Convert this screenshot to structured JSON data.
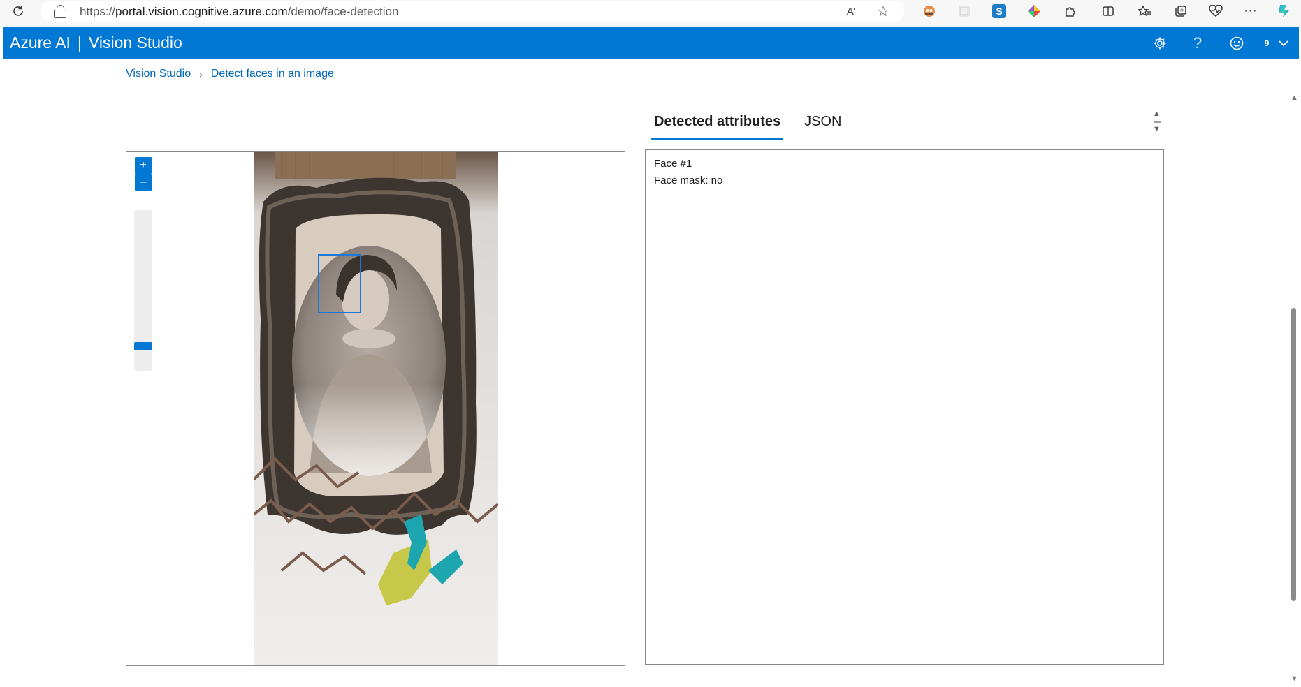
{
  "browser": {
    "url_prefix": "https://",
    "url_host": "portal.vision.cognitive.azure.com",
    "url_path": "/demo/face-detection",
    "refresh_icon": "refresh-icon",
    "lock_icon": "lock-icon",
    "read_aloud_label": "A’",
    "extension_icons": [
      "favorite-star-icon",
      "extension-avatar-icon",
      "extension-grid-icon",
      "extension-s-icon",
      "extension-diamond-icon",
      "extensions-puzzle-icon",
      "split-screen-icon",
      "favorites-icon",
      "collections-icon",
      "browser-essentials-icon",
      "more-icon",
      "copilot-icon"
    ],
    "more_label": "···"
  },
  "header": {
    "brand": "Azure AI",
    "separator": "|",
    "product": "Vision Studio",
    "notification_count": "9",
    "bar_color": "#0078d4"
  },
  "breadcrumb": {
    "items": [
      "Vision Studio",
      "Detect faces in an image"
    ]
  },
  "tabs": [
    {
      "label": "Detected attributes",
      "active": true
    },
    {
      "label": "JSON",
      "active": false
    }
  ],
  "viewer": {
    "zoom_in_label": "+",
    "zoom_out_label": "–",
    "zoom_level": 0.08,
    "image_description_icon": "photo-of-framed-portrait",
    "faces_detected": 1
  },
  "attributes": {
    "lines": [
      "Face #1",
      "Face mask: no"
    ]
  }
}
